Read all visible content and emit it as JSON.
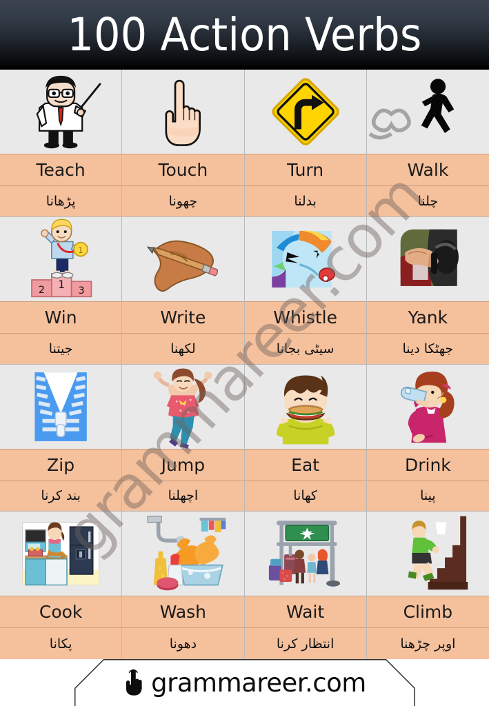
{
  "header": {
    "title": "100 Action Verbs",
    "bg_color_top": "#3b4450",
    "bg_color_bottom": "#000000",
    "text_color": "#ffffff"
  },
  "theme": {
    "label_band_color": "#f5c09c",
    "grid_line_color": "#cf9b78",
    "image_cell_color": "#e9e9e9",
    "watermark_color": "#6e645f"
  },
  "watermark": {
    "text": "grammareer.com"
  },
  "grid": {
    "columns": 4,
    "rows": 4,
    "cells": [
      {
        "english": "Teach",
        "urdu": "پڑھانا",
        "icon": "teacher-pointing-illustration"
      },
      {
        "english": "Touch",
        "urdu": "چھونا",
        "icon": "pointing-hand-illustration"
      },
      {
        "english": "Turn",
        "urdu": "بدلنا",
        "icon": "turn-right-road-sign-illustration"
      },
      {
        "english": "Walk",
        "urdu": "چلنا",
        "icon": "walking-pedestrian-illustration"
      },
      {
        "english": "Win",
        "urdu": "جیتنا",
        "icon": "boy-on-podium-with-medal-illustration"
      },
      {
        "english": "Write",
        "urdu": "لکھنا",
        "icon": "hand-holding-pencil-illustration"
      },
      {
        "english": "Whistle",
        "urdu": "سیٹی بجانا",
        "icon": "pony-blowing-whistle-illustration"
      },
      {
        "english": "Yank",
        "urdu": "جھٹکا دینا",
        "icon": "hand-pulling-cord-photo"
      },
      {
        "english": "Zip",
        "urdu": "بند کرنا",
        "icon": "open-zipper-illustration"
      },
      {
        "english": "Jump",
        "urdu": "اچھلنا",
        "icon": "girl-jumping-illustration"
      },
      {
        "english": "Eat",
        "urdu": "کھانا",
        "icon": "boy-eating-burger-illustration"
      },
      {
        "english": "Drink",
        "urdu": "پینا",
        "icon": "woman-drinking-water-illustration"
      },
      {
        "english": "Cook",
        "urdu": "پکانا",
        "icon": "kitchen-cooking-illustration"
      },
      {
        "english": "Wash",
        "urdu": "دھونا",
        "icon": "gloves-washing-in-basin-illustration"
      },
      {
        "english": "Wait",
        "urdu": "انتظار کرنا",
        "icon": "people-waiting-at-airport-illustration"
      },
      {
        "english": "Climb",
        "urdu": "اوپر چڑھنا",
        "icon": "boy-climbing-stairs-illustration"
      }
    ]
  },
  "footer": {
    "site": "grammareer.com",
    "icon": "pointing-hand-cursor-icon"
  }
}
